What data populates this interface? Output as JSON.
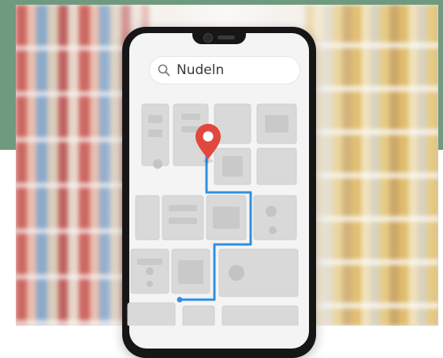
{
  "search": {
    "query": "Nudeln"
  },
  "icons": {
    "search": "search-icon",
    "pin": "map-pin-icon"
  },
  "colors": {
    "frame_accent": "#6f9a80",
    "route": "#2f8fe0",
    "pin": "#e2473d",
    "phone_body": "#161616",
    "map_block": "#d9d9d9",
    "screen_bg": "#f4f4f4"
  }
}
